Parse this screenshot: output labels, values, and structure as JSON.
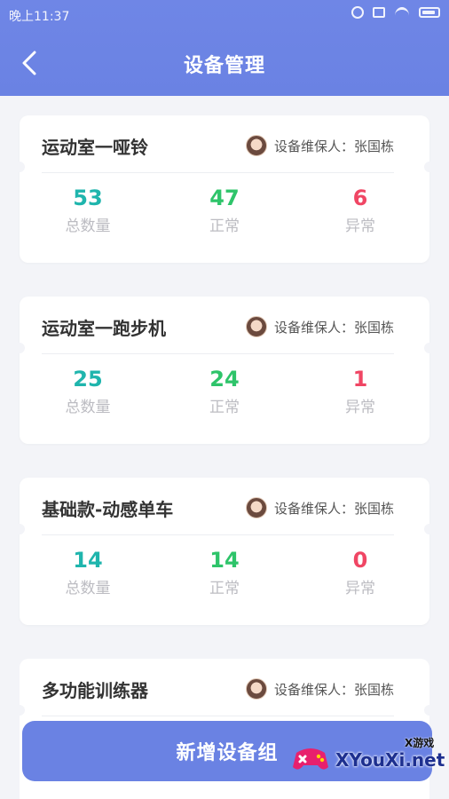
{
  "status_bar": {
    "time": "晚上11:37",
    "icons": [
      "alarm-off-icon",
      "sim-box-icon",
      "wifi-icon",
      "battery-icon"
    ]
  },
  "header": {
    "title": "设备管理",
    "back_icon": "chevron-left-icon"
  },
  "colors": {
    "header": "#6a82e3",
    "total": "#1fb5ad",
    "normal": "#2ec46a",
    "abnormal": "#f04664"
  },
  "groups": [
    {
      "name": "运动室一哑铃",
      "maintainer": "设备维保人：张国栋",
      "total_value": "53",
      "total_label": "总数量",
      "normal_value": "47",
      "normal_label": "正常",
      "abnormal_value": "6",
      "abnormal_label": "异常"
    },
    {
      "name": "运动室一跑步机",
      "maintainer": "设备维保人：张国栋",
      "total_value": "25",
      "total_label": "总数量",
      "normal_value": "24",
      "normal_label": "正常",
      "abnormal_value": "1",
      "abnormal_label": "异常"
    },
    {
      "name": "基础款-动感单车",
      "maintainer": "设备维保人：张国栋",
      "total_value": "14",
      "total_label": "总数量",
      "normal_value": "14",
      "normal_label": "正常",
      "abnormal_value": "0",
      "abnormal_label": "异常"
    },
    {
      "name": "多功能训练器",
      "maintainer": "设备维保人：张国栋"
    }
  ],
  "footer": {
    "add_button_label": "新增设备组"
  },
  "watermark": {
    "brand_text": "XYouXi.net",
    "small_text": "X游戏"
  }
}
